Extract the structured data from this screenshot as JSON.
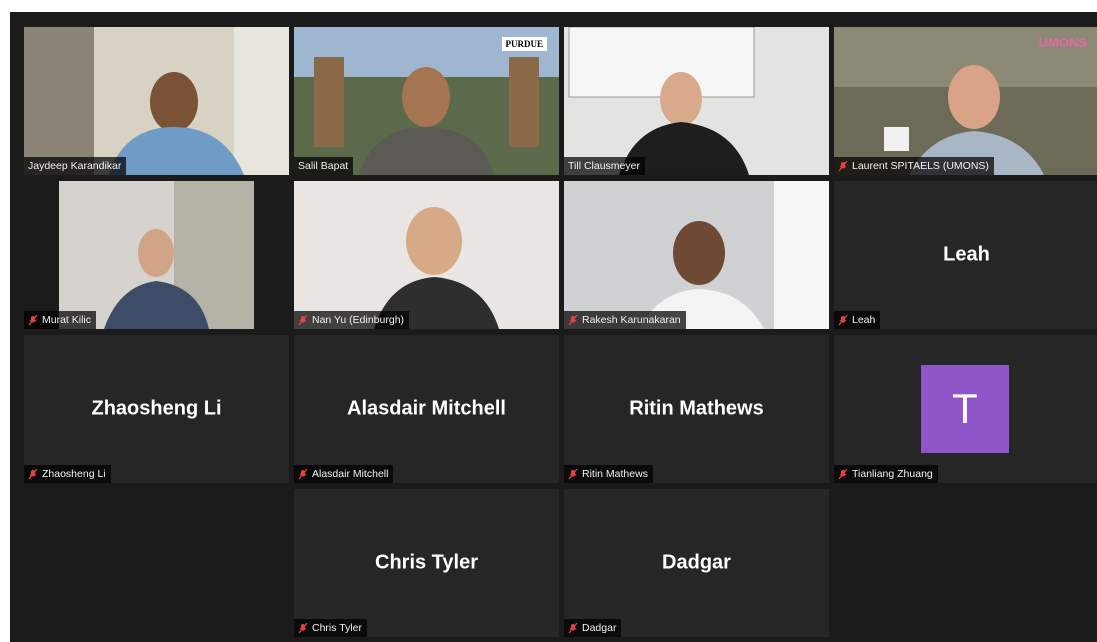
{
  "participants": [
    {
      "name": "Jaydeep Karandikar",
      "muted": false,
      "video": true,
      "active": true
    },
    {
      "name": "Salil Bapat",
      "muted": false,
      "video": true
    },
    {
      "name": "Till Clausmeyer",
      "muted": false,
      "video": true
    },
    {
      "name": "Laurent SPITAELS (UMONS)",
      "muted": true,
      "video": true
    },
    {
      "name": "Murat Kilic",
      "muted": true,
      "video": true
    },
    {
      "name": "Nan Yu (Edinburgh)",
      "muted": true,
      "video": true
    },
    {
      "name": "Rakesh Karunakaran",
      "muted": true,
      "video": true
    },
    {
      "name": "Leah",
      "muted": true,
      "video": false
    },
    {
      "name": "Zhaosheng Li",
      "muted": true,
      "video": false
    },
    {
      "name": "Alasdair Mitchell",
      "muted": true,
      "video": false
    },
    {
      "name": "Ritin Mathews",
      "muted": true,
      "video": false
    },
    {
      "name": "Tianliang Zhuang",
      "muted": true,
      "video": false,
      "avatar_letter": "T",
      "avatar_color": "#8e56c9"
    },
    {
      "name": "Chris Tyler",
      "muted": true,
      "video": false
    },
    {
      "name": "Dadgar",
      "muted": true,
      "video": false
    }
  ],
  "background_logos": {
    "purdue": "PURDUE",
    "umons": "UMONS"
  },
  "colors": {
    "stage": "#1b1b1b",
    "tile": "#262626",
    "active_border": "#dfe77a",
    "mute_red": "#e04343"
  }
}
